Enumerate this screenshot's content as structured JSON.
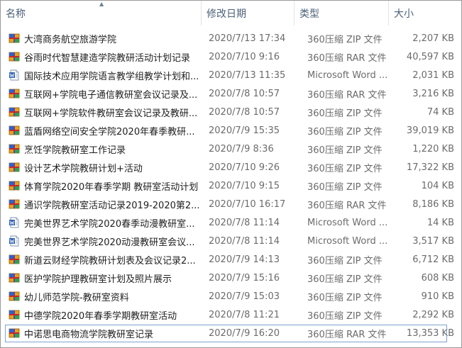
{
  "columns": {
    "name": "名称",
    "date": "修改日期",
    "type": "类型",
    "size": "大小"
  },
  "files": [
    {
      "name": "大湾商务航空旅游学院",
      "date": "2020/7/13 17:34",
      "type": "360压缩 ZIP 文件",
      "size": "2,207 KB",
      "icon": "archive-icon"
    },
    {
      "name": "谷雨时代智慧建造学院教研活动计划记录",
      "date": "2020/7/10 9:16",
      "type": "360压缩 RAR 文件",
      "size": "40,597 KB",
      "icon": "archive-icon"
    },
    {
      "name": "国际技术应用学院语言教学组教学计划和...",
      "date": "2020/7/13 11:35",
      "type": "Microsoft Word ...",
      "size": "2,031 KB",
      "icon": "word-doc-icon"
    },
    {
      "name": "互联网+学院电子通信教研室会议记录及...",
      "date": "2020/7/8 10:57",
      "type": "360压缩 RAR 文件",
      "size": "3,216 KB",
      "icon": "archive-icon"
    },
    {
      "name": "互联网+学院软件教研室会议记录及教研...",
      "date": "2020/7/8 10:57",
      "type": "360压缩 ZIP 文件",
      "size": "74 KB",
      "icon": "archive-icon"
    },
    {
      "name": "蓝盾网络空间安全学院2020年春季教研...",
      "date": "2020/7/9 15:35",
      "type": "360压缩 ZIP 文件",
      "size": "39,019 KB",
      "icon": "archive-icon"
    },
    {
      "name": "烹饪学院教研室工作记录",
      "date": "2020/7/9 8:36",
      "type": "360压缩 ZIP 文件",
      "size": "1,220 KB",
      "icon": "archive-icon"
    },
    {
      "name": "设计艺术学院教研计划+活动",
      "date": "2020/7/10 9:26",
      "type": "360压缩 ZIP 文件",
      "size": "17,322 KB",
      "icon": "archive-icon"
    },
    {
      "name": "体育学院2020年春季学期 教研室活动计划",
      "date": "2020/7/10 9:15",
      "type": "360压缩 ZIP 文件",
      "size": "104 KB",
      "icon": "archive-icon"
    },
    {
      "name": "通识学院教研室活动记录2019-2020第2...",
      "date": "2020/7/10 16:17",
      "type": "360压缩 RAR 文件",
      "size": "8,186 KB",
      "icon": "archive-icon"
    },
    {
      "name": "完美世界艺术学院2020春季动漫教研室...",
      "date": "2020/7/8 11:14",
      "type": "Microsoft Word ...",
      "size": "14 KB",
      "icon": "word-doc-icon"
    },
    {
      "name": "完美世界艺术学院2020动漫教研室会议...",
      "date": "2020/7/8 11:14",
      "type": "Microsoft Word ...",
      "size": "3,517 KB",
      "icon": "word-doc-icon"
    },
    {
      "name": "新道云财经学院教研计划表及会议记录2...",
      "date": "2020/7/9 14:13",
      "type": "360压缩 ZIP 文件",
      "size": "6,712 KB",
      "icon": "archive-icon"
    },
    {
      "name": "医护学院护理教研室计划及照片展示",
      "date": "2020/7/9 15:16",
      "type": "360压缩 ZIP 文件",
      "size": "608 KB",
      "icon": "archive-icon"
    },
    {
      "name": "幼儿师范学院-教研室资料",
      "date": "2020/7/9 15:03",
      "type": "360压缩 ZIP 文件",
      "size": "910 KB",
      "icon": "archive-icon"
    },
    {
      "name": "中德学院2020年春季学期教研室活动",
      "date": "2020/7/8 11:21",
      "type": "360压缩 ZIP 文件",
      "size": "2,292 KB",
      "icon": "archive-icon"
    },
    {
      "name": "中诺思电商物流学院教研室记录",
      "date": "2020/7/9 16:20",
      "type": "360压缩 RAR 文件",
      "size": "13,353 KB",
      "icon": "archive-icon",
      "selected": true
    }
  ]
}
